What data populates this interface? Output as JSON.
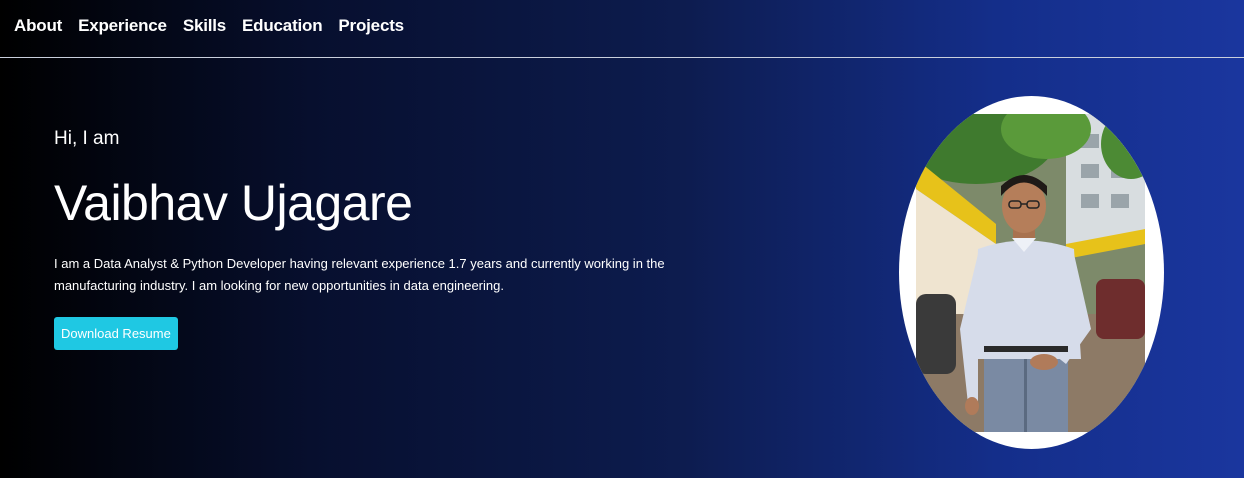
{
  "nav": {
    "items": [
      {
        "label": "About"
      },
      {
        "label": "Experience"
      },
      {
        "label": "Skills"
      },
      {
        "label": "Education"
      },
      {
        "label": "Projects"
      }
    ]
  },
  "hero": {
    "greeting": "Hi, I am",
    "name": "Vaibhav Ujagare",
    "bio": "I am a Data Analyst & Python Developer having relevant experience 1.7 years and currently working in the manufacturing industry. I am looking for new opportunities in data engineering.",
    "button_label": "Download Resume"
  },
  "colors": {
    "button": "#1fc8e3",
    "gradient_start": "#000000",
    "gradient_end": "#1a369e"
  }
}
